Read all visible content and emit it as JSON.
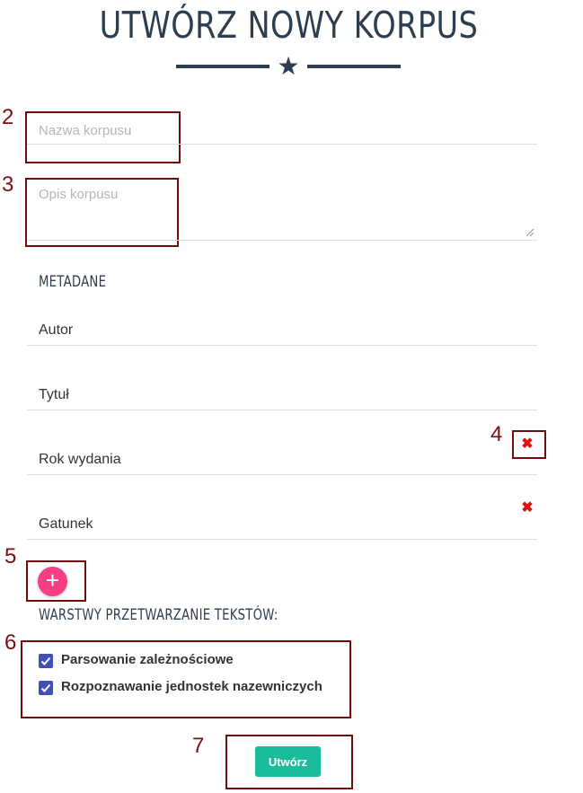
{
  "page": {
    "title": "UTWÓRZ NOWY KORPUS"
  },
  "form": {
    "name_placeholder": "Nazwa korpusu",
    "description_placeholder": "Opis korpusu"
  },
  "metadata": {
    "heading": "METADANE",
    "fields": [
      {
        "label": "Autor",
        "removable": false
      },
      {
        "label": "Tytuł",
        "removable": false
      },
      {
        "label": "Rok wydania",
        "removable": true
      },
      {
        "label": "Gatunek",
        "removable": true
      }
    ],
    "remove_icon": "close-icon",
    "add_icon": "plus-icon"
  },
  "layers": {
    "heading": "WARSTWY PRZETWARZANIE TEKSTÓW:",
    "options": [
      {
        "label": "Parsowanie zależnościowe",
        "checked": true
      },
      {
        "label": "Rozpoznawanie jednostek nazewniczych",
        "checked": true
      }
    ]
  },
  "submit": {
    "label": "Utwórz"
  },
  "annotations": {
    "labels": [
      "2",
      "3",
      "4",
      "5",
      "6",
      "7"
    ],
    "color": "#6d0f0f"
  },
  "colors": {
    "title": "#2c3e50",
    "accent_add": "#f53e83",
    "submit": "#1abc9c",
    "checkbox": "#3f51b5",
    "remove": "#e01010"
  }
}
